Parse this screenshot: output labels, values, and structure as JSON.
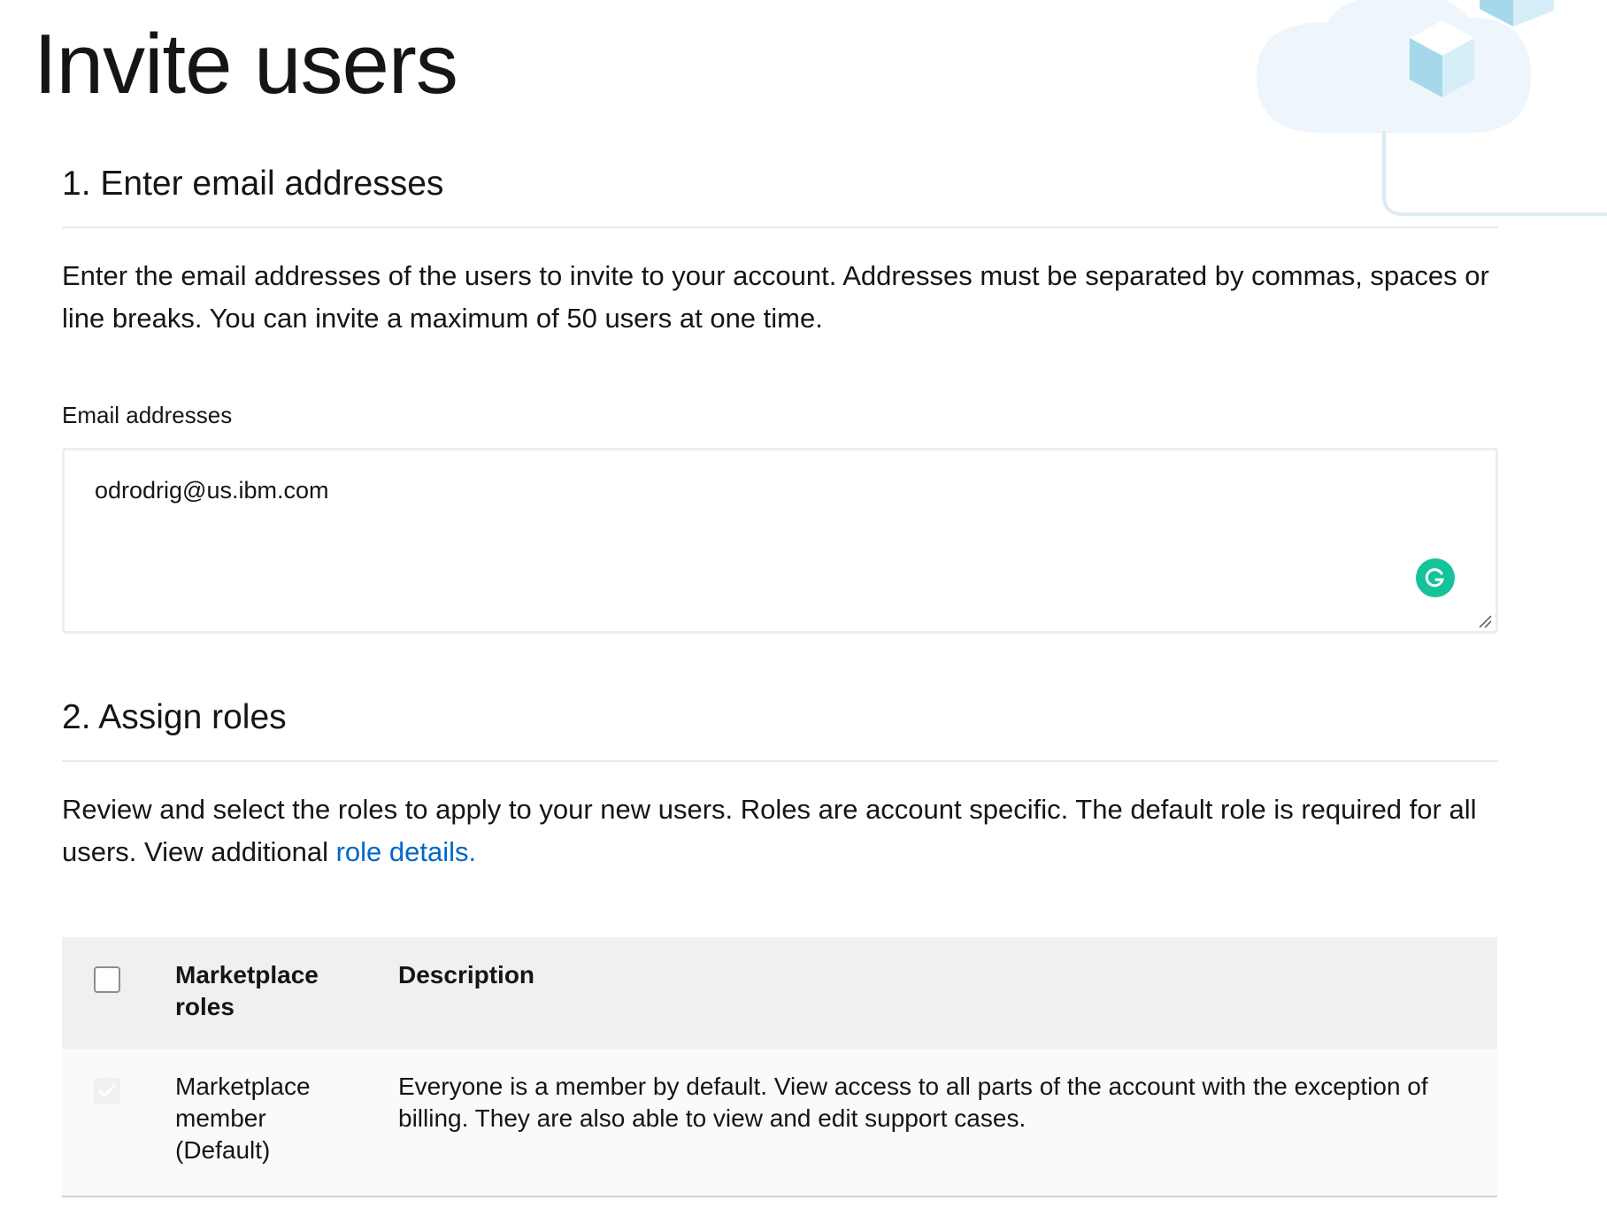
{
  "page": {
    "title": "Invite users"
  },
  "section1": {
    "heading": "1. Enter email addresses",
    "description": "Enter the email addresses of the users to invite to your account. Addresses must be separated by commas, spaces or line breaks. You can invite a maximum of 50 users at one time.",
    "email_label": "Email addresses",
    "email_value": "odrodrig@us.ibm.com",
    "grammarly_icon": "grammarly-icon"
  },
  "section2": {
    "heading": "2. Assign roles",
    "description_prefix": "Review and select the roles to apply to your new users. Roles are account specific. The default role is required for all users. View additional ",
    "link_text": "role details."
  },
  "table": {
    "headers": {
      "roles_line1": "Marketplace",
      "roles_line2": "roles",
      "description": "Description"
    },
    "rows": [
      {
        "role_line1": "Marketplace",
        "role_line2": "member",
        "role_line3": "(Default)",
        "description_line1": "Everyone is a member by default. View access to all parts of the account with the exception of",
        "description_line2": "billing. They are also able to view and edit support cases.",
        "checked": true,
        "disabled": true
      }
    ]
  },
  "colors": {
    "link": "#0066cc",
    "grammarly": "#15c39a",
    "table_header_bg": "#f0f0f0",
    "illustration_cloud": "#eef5fb",
    "illustration_cube": "#a5d8ea"
  }
}
